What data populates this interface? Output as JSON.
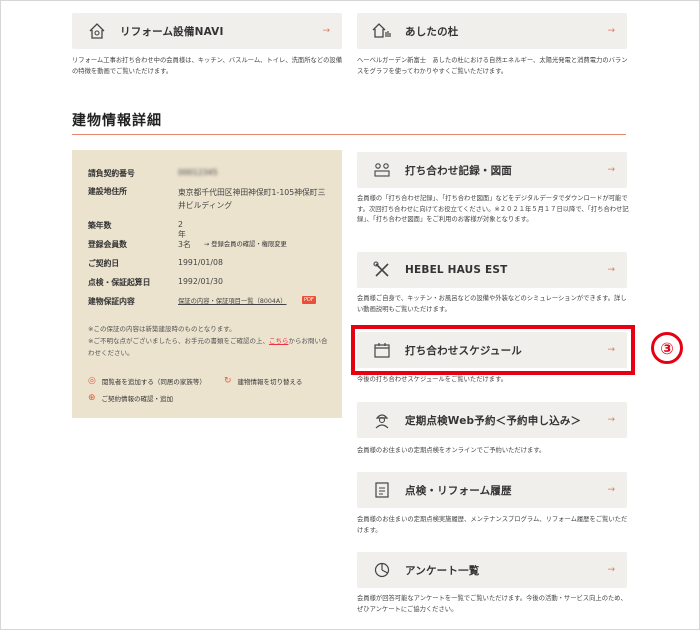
{
  "top_cards": {
    "left": {
      "title": "リフォーム設備NAVI",
      "icon": "house-tool-icon",
      "desc": "リフォーム工事お打ち合わせ中の会員様は、キッチン、バスルーム、トイレ、洗面所などの設備の特徴を動画でご覧いただけます。"
    },
    "right": {
      "title": "あしたの杜",
      "icon": "house-eco-icon",
      "desc": "ヘーベルガーデン新富士　あしたの杜における自然エネルギー、太陽光発電と消費電力のバランスをグラフを使ってわかりやすくご覧いただけます。"
    }
  },
  "section": {
    "title": "建物情報詳細"
  },
  "info": {
    "rows": [
      {
        "k": "請負契約番号",
        "v": "00012345"
      },
      {
        "k": "建設地住所",
        "v": "東京都千代田区神田神保町1-105神保町三井ビルディング"
      },
      {
        "k": "築年数",
        "v": "2年"
      },
      {
        "k": "登録会員数",
        "v": "3名"
      },
      {
        "k": "ご契約日",
        "v": "1991/01/08"
      },
      {
        "k": "点検・保証起算日",
        "v": "1992/01/30"
      },
      {
        "k": "建物保証内容",
        "v": "保証の内容・保証項目一覧（8004A）"
      }
    ],
    "member_link": "→ 登録会員の確認・権限変更",
    "pdf_label": "PDF",
    "note1": "※この保証の内容は新築建設時のものとなります。",
    "note2_pre": "※ご不明な点がございましたら、お手元の書類をご確認の上、",
    "note2_link": "こちら",
    "note2_post": "からお問い合わせください。",
    "actions": {
      "add_viewer": "閲覧者を追加する（同居の家族等）",
      "switch": "建物情報を切り替える",
      "contract": "ご契約情報の確認・追加"
    }
  },
  "right_cards": [
    {
      "title": "打ち合わせ記録・図面",
      "icon": "meeting-icon",
      "desc": "会員様の「打ち合わせ記録」、「打ち合わせ図面」などをデジタルデータでダウンロードが可能です。次回打ち合わせに向けてお役立てください。※２０２１年５月１７日以降で、「打ち合わせ記録」、「打ち合わせ図面」をご利用のお客様が対象となります。"
    },
    {
      "title": "HEBEL HAUS EST",
      "icon": "tools-icon",
      "desc": "会員様ご自身で、キッチン・お風呂などの設備や外装などのシミュレーションができます。詳しい動画説明もご覧いただけます。"
    },
    {
      "title": "打ち合わせスケジュール",
      "icon": "calendar-icon",
      "desc": "今後の打ち合わせスケジュールをご覧いただけます。"
    },
    {
      "title": "定期点検Web予約＜予約申し込み＞",
      "icon": "worker-icon",
      "desc": "会員様のお住まいの定期点検をオンラインでご予約いただけます。"
    },
    {
      "title": "点検・リフォーム履歴",
      "icon": "history-icon",
      "desc": "会員様のお住まいの定期点検実施履歴、メンテナンスプログラム、リフォーム履歴をご覧いただけます。"
    },
    {
      "title": "アンケート一覧",
      "icon": "survey-icon",
      "desc": "会員様が回答可能なアンケートを一覧でご覧いただけます。今後の活動・サービス向上のため、ぜひアンケートにご協力ください。"
    }
  ],
  "arrow": "→",
  "badge": "③"
}
